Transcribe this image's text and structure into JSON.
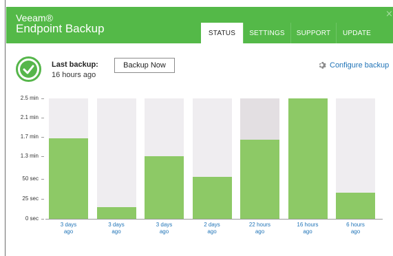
{
  "app": {
    "logo_top": "Veeam®",
    "logo_bottom": "Endpoint Backup",
    "close_glyph": "×"
  },
  "tabs": [
    {
      "label": "STATUS",
      "active": true
    },
    {
      "label": "SETTINGS",
      "active": false
    },
    {
      "label": "SUPPORT",
      "active": false
    },
    {
      "label": "UPDATE",
      "active": false
    }
  ],
  "status": {
    "last_backup_label": "Last backup:",
    "last_backup_value": "16 hours ago",
    "backup_now_label": "Backup Now",
    "configure_label": "Configure backup",
    "status_icon": "check-icon"
  },
  "colors": {
    "brand_green": "#54b948",
    "bar_green": "#8dc966",
    "link_blue": "#1f73b7"
  },
  "chart_data": {
    "type": "bar",
    "categories": [
      "3 days ago",
      "3 days ago",
      "3 days ago",
      "2 days ago",
      "22 hours ago",
      "16 hours ago",
      "6 hours ago"
    ],
    "category_lines": [
      [
        "3 days",
        "ago"
      ],
      [
        "3 days",
        "ago"
      ],
      [
        "3 days",
        "ago"
      ],
      [
        "2 days",
        "ago"
      ],
      [
        "22 hours",
        "ago"
      ],
      [
        "16 hours",
        "ago"
      ],
      [
        "6 hours",
        "ago"
      ]
    ],
    "values": [
      100,
      15,
      78,
      52,
      99,
      150,
      33
    ],
    "unit": "seconds",
    "y_ticks": [
      {
        "value": 0,
        "label": "0 sec"
      },
      {
        "value": 25,
        "label": "25 sec"
      },
      {
        "value": 50,
        "label": "50 sec"
      },
      {
        "value": 78,
        "label": "1.3 min"
      },
      {
        "value": 102,
        "label": "1.7 min"
      },
      {
        "value": 126,
        "label": "2.1 min"
      },
      {
        "value": 150,
        "label": "2.5 min"
      }
    ],
    "ylim": [
      0,
      150
    ],
    "highlighted_index": 4,
    "title": "",
    "xlabel": "",
    "ylabel": ""
  }
}
